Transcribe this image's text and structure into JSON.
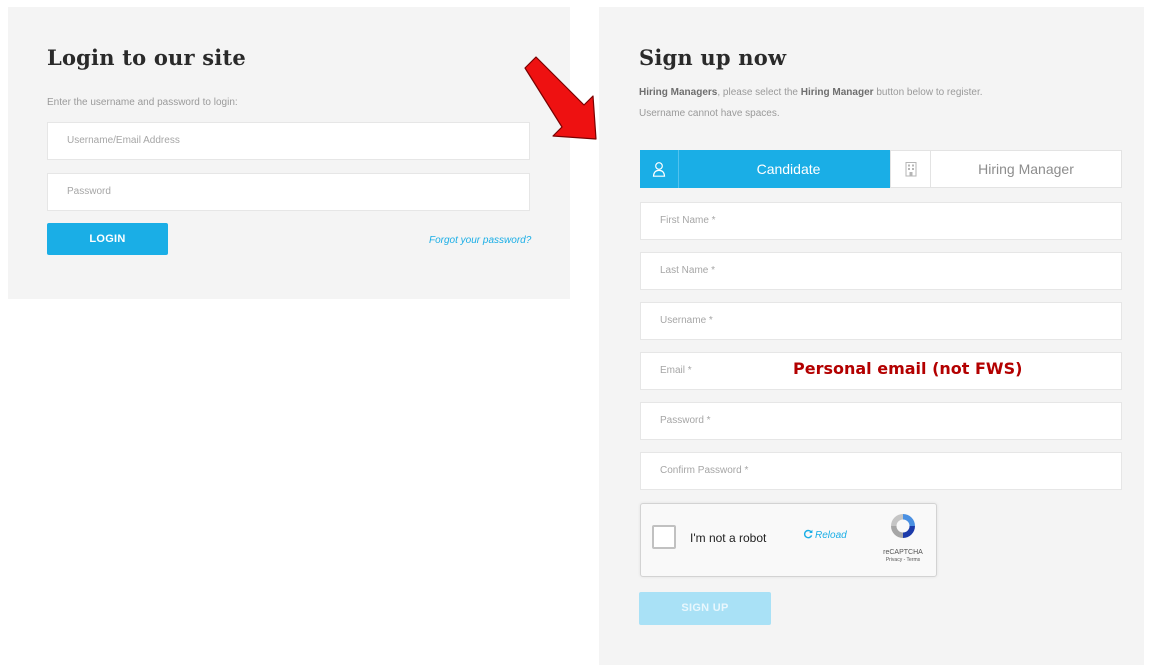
{
  "login": {
    "title": "Login to our site",
    "subtitle": "Enter the username and password to login:",
    "username_placeholder": "Username/Email Address",
    "password_placeholder": "Password",
    "login_button": "LOGIN",
    "forgot_link": "Forgot your password?"
  },
  "signup": {
    "title": "Sign up now",
    "desc_bold_1": "Hiring Managers",
    "desc_text_1": ", please select the ",
    "desc_bold_2": "Hiring Manager",
    "desc_text_2": " button below to register.",
    "desc_line_2": "Username cannot have spaces.",
    "tabs": [
      {
        "label": "Candidate",
        "icon": "user-icon",
        "active": true
      },
      {
        "label": "Hiring Manager",
        "icon": "building-icon",
        "active": false
      }
    ],
    "fields": {
      "first_name": "First Name *",
      "last_name": "Last Name *",
      "username": "Username *",
      "email": "Email *",
      "password": "Password *",
      "confirm_password": "Confirm Password *"
    },
    "email_note": "Personal email (not FWS)",
    "recaptcha": {
      "label": "I'm not a robot",
      "reload": "Reload",
      "brand": "reCAPTCHA",
      "terms": "Privacy - Terms"
    },
    "signup_button": "SIGN UP"
  },
  "colors": {
    "accent": "#1aaee6",
    "annotation_red": "#ee1111",
    "note_text": "#b30000",
    "panel_bg": "#f4f4f4"
  }
}
